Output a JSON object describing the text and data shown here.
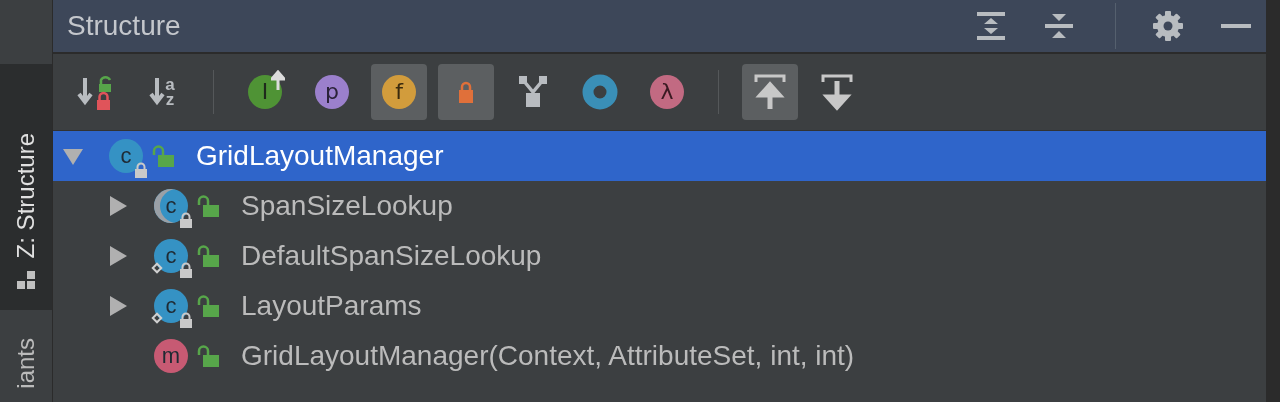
{
  "side_tabs": [
    {
      "label": "Z: Structure",
      "selected": true
    },
    {
      "label": "iants",
      "selected": false
    }
  ],
  "panel": {
    "title": "Structure"
  },
  "toolbar": [
    {
      "kind": "sort_visibility",
      "selected": false
    },
    {
      "kind": "sort_alpha",
      "glyph": "a",
      "glyph2": "z",
      "selected": false
    },
    {
      "kind": "separator"
    },
    {
      "kind": "inherited",
      "glyph": "I",
      "selected": false
    },
    {
      "kind": "properties",
      "glyph": "p",
      "selected": false
    },
    {
      "kind": "fields",
      "glyph": "f",
      "selected": true
    },
    {
      "kind": "non_public",
      "selected": true
    },
    {
      "kind": "anonymous",
      "selected": false
    },
    {
      "kind": "ring",
      "selected": false
    },
    {
      "kind": "lambdas",
      "glyph": "λ",
      "selected": false
    },
    {
      "kind": "separator"
    },
    {
      "kind": "scroll_to_source",
      "selected": true
    },
    {
      "kind": "scroll_from_source",
      "selected": false
    }
  ],
  "tree": [
    {
      "label": "GridLayoutManager",
      "kind": "class",
      "glyph": "c",
      "selected": true,
      "expanded": true,
      "children": [
        {
          "label": "SpanSizeLookup",
          "kind": "abstract_class",
          "glyph": "c",
          "selected": false,
          "expanded": false
        },
        {
          "label": "DefaultSpanSizeLookup",
          "kind": "static_class",
          "glyph": "c",
          "selected": false,
          "expanded": false
        },
        {
          "label": "LayoutParams",
          "kind": "static_class",
          "glyph": "c",
          "selected": false,
          "expanded": false
        },
        {
          "label": "GridLayoutManager(Context, AttributeSet, int, int)",
          "kind": "method",
          "glyph": "m",
          "selected": false
        }
      ]
    }
  ]
}
